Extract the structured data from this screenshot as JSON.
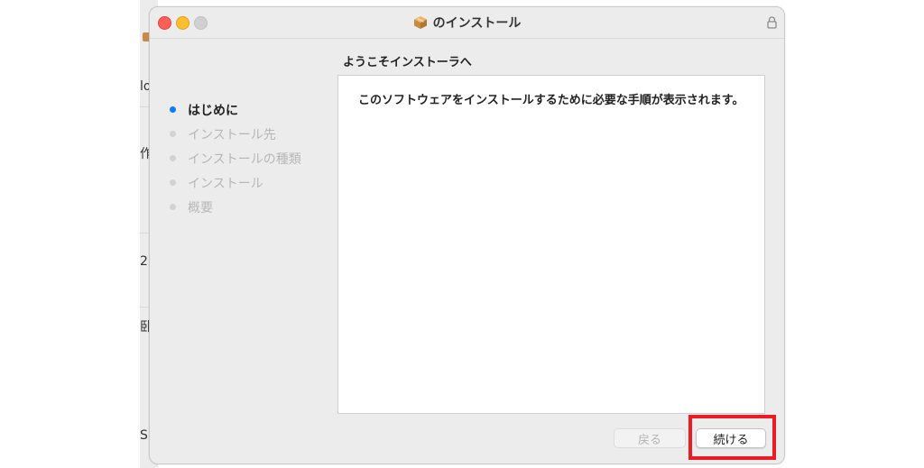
{
  "background_app": {
    "fragments": [
      "lo",
      "作",
      "2",
      "卧",
      "S"
    ]
  },
  "window": {
    "title": "のインストール",
    "heading": "ようこそインストーラへ",
    "steps": [
      {
        "label": "はじめに",
        "active": true
      },
      {
        "label": "インストール先",
        "active": false
      },
      {
        "label": "インストールの種類",
        "active": false
      },
      {
        "label": "インストール",
        "active": false
      },
      {
        "label": "概要",
        "active": false
      }
    ],
    "body_text": "このソフトウェアをインストールするために必要な手順が表示されます。",
    "buttons": {
      "back_label": "戻る",
      "continue_label": "続ける"
    }
  },
  "colors": {
    "active_step": "#0a7cff",
    "highlight_box": "#ec1c24",
    "close": "#fe5f57",
    "minimize": "#febc2e",
    "zoom": "#d0d0d0"
  },
  "icons": {
    "title_icon": "package-icon",
    "lock": "lock-icon"
  }
}
